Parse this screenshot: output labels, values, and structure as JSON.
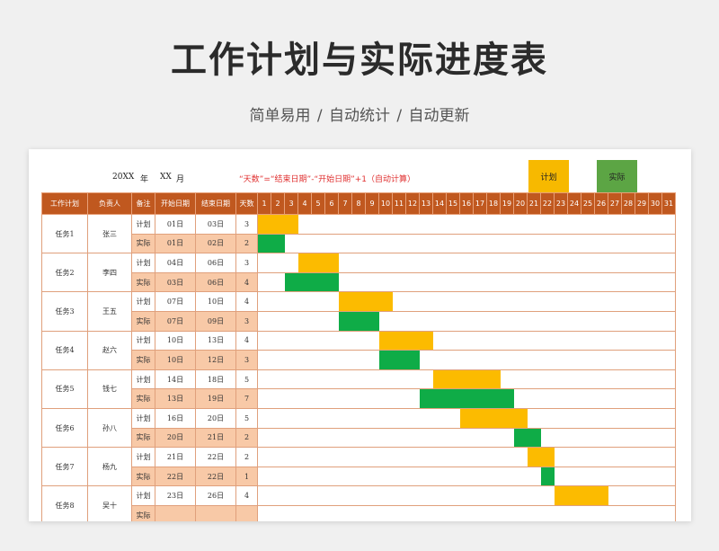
{
  "page": {
    "title": "工作计划与实际进度表",
    "subtitle": "简单易用  /  自动统计  /  自动更新"
  },
  "sheet": {
    "year_label": "20XX",
    "year_unit": "年",
    "month_label": "XX",
    "month_unit": "月",
    "formula_note": "“天数”=“结束日期”-“开始日期”+1（自动计算）",
    "legend_plan": "计划",
    "legend_actual": "实际",
    "colors": {
      "header": "#c0581f",
      "plan": "#fcbb00",
      "actual": "#0fac47",
      "actual_row": "#f8c9a7"
    },
    "headers": [
      "工作计划",
      "负责人",
      "备注",
      "开始日期",
      "结束日期",
      "天数"
    ],
    "days": [
      "1",
      "2",
      "3",
      "4",
      "5",
      "6",
      "7",
      "8",
      "9",
      "10",
      "11",
      "12",
      "13",
      "14",
      "15",
      "16",
      "17",
      "18",
      "19",
      "20",
      "21",
      "22",
      "23",
      "24",
      "25",
      "26",
      "27",
      "28",
      "29",
      "30",
      "31"
    ],
    "tasks": [
      {
        "name": "任务1",
        "owner": "张三",
        "plan": {
          "label": "计划",
          "start": "01日",
          "end": "03日",
          "days": "3"
        },
        "actual": {
          "label": "实际",
          "start": "01日",
          "end": "02日",
          "days": "2"
        }
      },
      {
        "name": "任务2",
        "owner": "李四",
        "plan": {
          "label": "计划",
          "start": "04日",
          "end": "06日",
          "days": "3"
        },
        "actual": {
          "label": "实际",
          "start": "03日",
          "end": "06日",
          "days": "4"
        }
      },
      {
        "name": "任务3",
        "owner": "王五",
        "plan": {
          "label": "计划",
          "start": "07日",
          "end": "10日",
          "days": "4"
        },
        "actual": {
          "label": "实际",
          "start": "07日",
          "end": "09日",
          "days": "3"
        }
      },
      {
        "name": "任务4",
        "owner": "赵六",
        "plan": {
          "label": "计划",
          "start": "10日",
          "end": "13日",
          "days": "4"
        },
        "actual": {
          "label": "实际",
          "start": "10日",
          "end": "12日",
          "days": "3"
        }
      },
      {
        "name": "任务5",
        "owner": "钱七",
        "plan": {
          "label": "计划",
          "start": "14日",
          "end": "18日",
          "days": "5"
        },
        "actual": {
          "label": "实际",
          "start": "13日",
          "end": "19日",
          "days": "7"
        }
      },
      {
        "name": "任务6",
        "owner": "孙八",
        "plan": {
          "label": "计划",
          "start": "16日",
          "end": "20日",
          "days": "5"
        },
        "actual": {
          "label": "实际",
          "start": "20日",
          "end": "21日",
          "days": "2"
        }
      },
      {
        "name": "任务7",
        "owner": "杨九",
        "plan": {
          "label": "计划",
          "start": "21日",
          "end": "22日",
          "days": "2"
        },
        "actual": {
          "label": "实际",
          "start": "22日",
          "end": "22日",
          "days": "1"
        }
      },
      {
        "name": "任务8",
        "owner": "吴十",
        "plan": {
          "label": "计划",
          "start": "23日",
          "end": "26日",
          "days": "4"
        },
        "actual": {
          "label": "实际",
          "start": "",
          "end": "",
          "days": ""
        }
      }
    ]
  }
}
